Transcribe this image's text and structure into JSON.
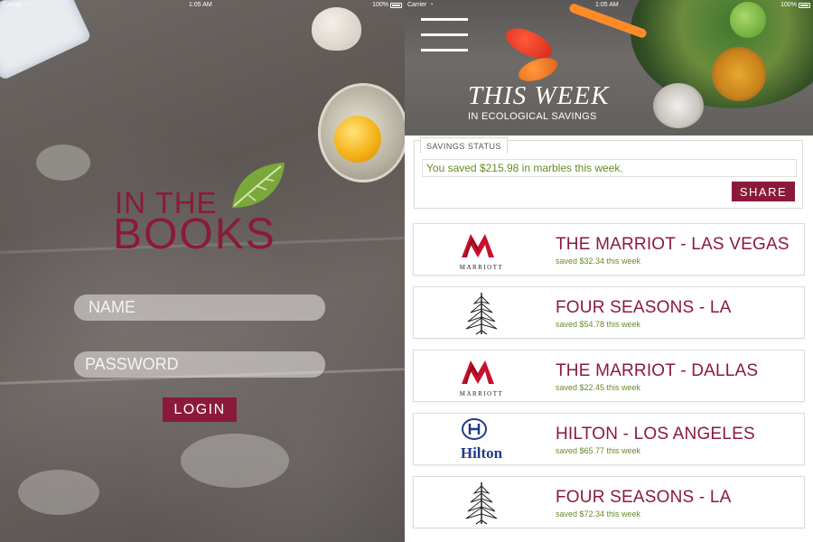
{
  "login_screen": {
    "statusbar": {
      "carrier": "Carrier",
      "time": "1:05 AM",
      "battery": "100%"
    },
    "logo": {
      "line1": "IN THE",
      "line2": "BOOKS"
    },
    "name_placeholder": "NAME",
    "password_placeholder": "PASSWORD",
    "login_label": "LOGIN"
  },
  "week_screen": {
    "statusbar": {
      "carrier": "Carrier",
      "time": "1:05 AM",
      "battery": "100%"
    },
    "hero": {
      "title": "THIS WEEK",
      "subtitle": "IN ECOLOGICAL SAVINGS"
    },
    "savings_status": {
      "tab_label": "SAVINGS STATUS",
      "message": "You saved $215.98 in marbles this week.",
      "share_label": "SHARE"
    },
    "hotels": [
      {
        "name": "THE MARRIOT - LAS VEGAS",
        "saved": "saved $32.34 this week",
        "brand": "marriott",
        "logo_text": "MARRIOTT"
      },
      {
        "name": "FOUR SEASONS - LA",
        "saved": "saved $54.78 this week",
        "brand": "four-seasons"
      },
      {
        "name": "THE MARRIOT - DALLAS",
        "saved": "saved $22.45 this week",
        "brand": "marriott",
        "logo_text": "MARRIOTT"
      },
      {
        "name": "HILTON - LOS ANGELES",
        "saved": "saved $65.77 this week",
        "brand": "hilton",
        "logo_text": "Hilton"
      },
      {
        "name": "FOUR SEASONS - LA",
        "saved": "saved $72.34 this week",
        "brand": "four-seasons"
      }
    ]
  },
  "colors": {
    "brand": "#8b1a3a",
    "savings_text": "#6a8a2a",
    "leaf": "#7aa83a"
  }
}
